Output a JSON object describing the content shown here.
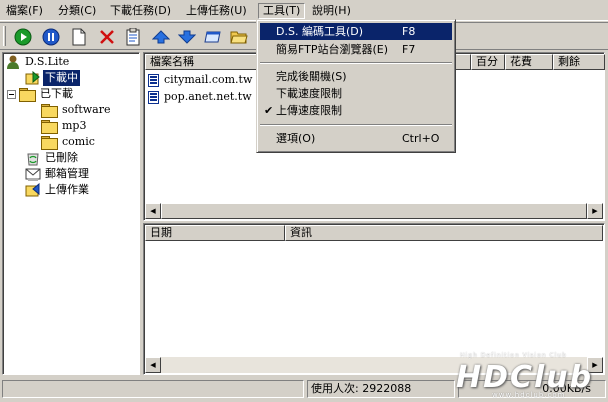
{
  "menubar": {
    "items": [
      {
        "label": "檔案(F)"
      },
      {
        "label": "分類(C)"
      },
      {
        "label": "下載任務(D)"
      },
      {
        "label": "上傳任務(U)"
      },
      {
        "label": "工具(T)"
      },
      {
        "label": "說明(H)"
      }
    ]
  },
  "toolbar": {
    "buttons": [
      "play-icon",
      "pause-icon",
      "new-file-icon",
      "delete-icon",
      "properties-icon",
      "move-up-icon",
      "move-down-icon",
      "window-icon",
      "open-folder-icon"
    ]
  },
  "tree": {
    "root": "D.S.Lite",
    "items": [
      {
        "label": "下載中",
        "selected": true
      },
      {
        "label": "已下載"
      },
      {
        "label": "software"
      },
      {
        "label": "mp3"
      },
      {
        "label": "comic"
      },
      {
        "label": "已刪除"
      },
      {
        "label": "郵箱管理"
      },
      {
        "label": "上傳作業"
      }
    ]
  },
  "tasks": {
    "columns": [
      "檔案名稱",
      "百分",
      "花費",
      "剩餘"
    ],
    "rows": [
      {
        "name": "citymail.com.tw"
      },
      {
        "name": "pop.anet.net.tw"
      }
    ]
  },
  "log": {
    "columns": [
      "日期",
      "資訊"
    ]
  },
  "status": {
    "users": "使用人次: 2922088",
    "speed": "0.00KB/s"
  },
  "tools_menu": {
    "items": [
      {
        "label": "D.S. 編碼工具(D)",
        "shortcut": "F8",
        "highlighted": true
      },
      {
        "label": "簡易FTP站台瀏覽器(E)",
        "shortcut": "F7"
      },
      {
        "label": "完成後關機(S)"
      },
      {
        "label": "下載速度限制"
      },
      {
        "label": "上傳速度限制",
        "checked": true
      },
      {
        "label": "選項(O)",
        "shortcut": "Ctrl+O"
      }
    ]
  },
  "watermark": {
    "brand": "HDClub",
    "tagline": "High Definition Vision Club",
    "url": "www.hdclub.com"
  },
  "colors": {
    "selection": "#0a246a",
    "face": "#d4d0c8",
    "window": "#ffffff"
  }
}
